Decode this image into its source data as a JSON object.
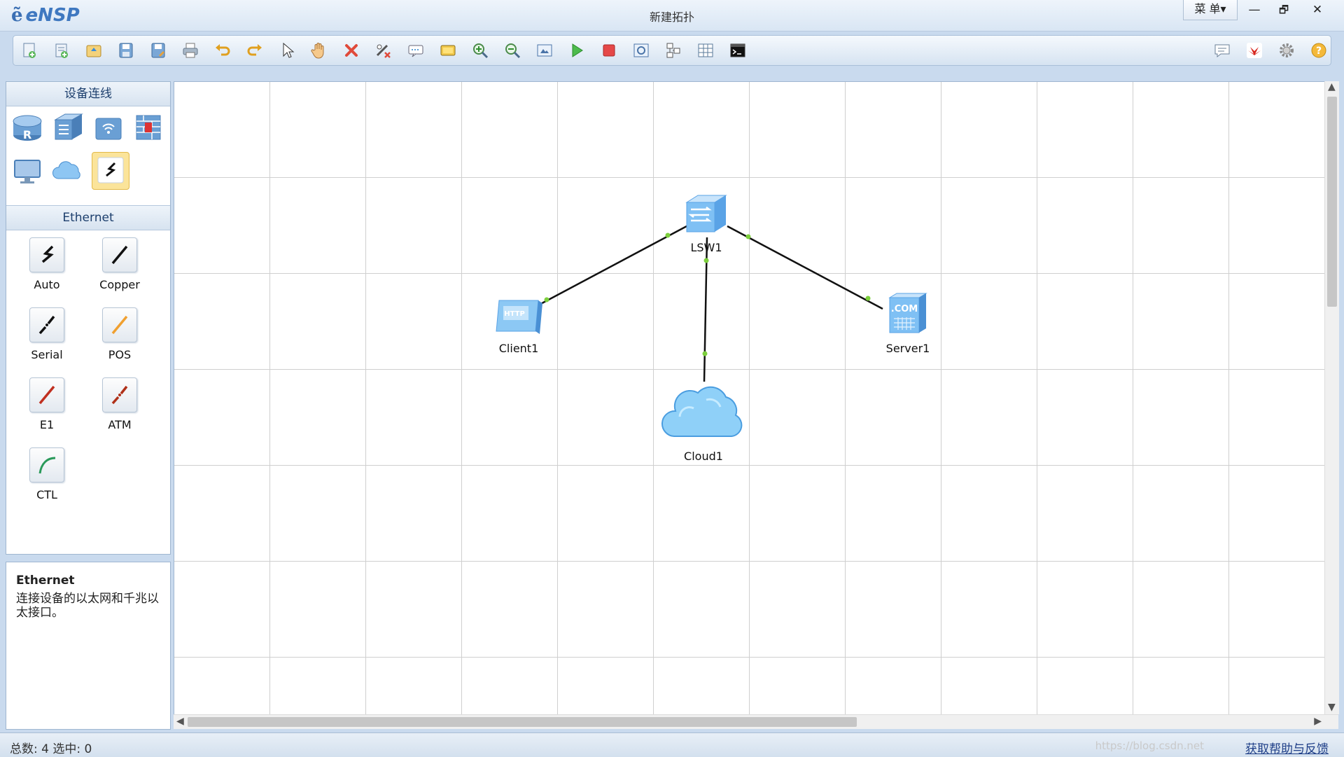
{
  "app": {
    "logo_mark": "ẽ",
    "name": "eNSP",
    "window_title": "新建拓扑",
    "menu_label": "菜 单▾",
    "minimize": "—",
    "restore": "🗗",
    "close": "✕"
  },
  "toolbar": {
    "left_icons": [
      "new-topology-icon",
      "new-example-icon",
      "open-icon",
      "save-icon",
      "save-as-icon",
      "print-icon",
      "undo-icon",
      "redo-icon",
      "select-pointer-icon",
      "hand-pan-icon",
      "delete-icon",
      "delete-link-icon",
      "text-note-icon",
      "palette-icon",
      "zoom-in-icon",
      "zoom-out-icon",
      "fit-view-icon",
      "start-device-icon",
      "stop-device-icon",
      "capture-icon",
      "topology-icon",
      "grid-icon",
      "terminal-icon"
    ],
    "right_icons": [
      "chat-icon",
      "huawei-logo-icon",
      "settings-icon",
      "help-icon"
    ]
  },
  "left_panel": {
    "device_header": "设备连线",
    "devices": [
      "router-icon",
      "switch-icon",
      "wlan-icon",
      "firewall-icon",
      "pc-terminal-icon",
      "cloud-icon",
      "cable-icon"
    ],
    "cable_header": "Ethernet",
    "cables": [
      {
        "label": "Auto",
        "color": "#111111"
      },
      {
        "label": "Copper",
        "color": "#111111"
      },
      {
        "label": "Serial",
        "color": "#111111"
      },
      {
        "label": "POS",
        "color": "#f0a030"
      },
      {
        "label": "E1",
        "color": "#c03020"
      },
      {
        "label": "ATM",
        "color": "#b03018"
      },
      {
        "label": "CTL",
        "color": "#2a9a5a"
      }
    ]
  },
  "info_panel": {
    "title": "Ethernet",
    "description": "连接设备的以太网和千兆以太接口。"
  },
  "topology": {
    "nodes": [
      {
        "id": "LSW1",
        "label": "LSW1",
        "type": "switch"
      },
      {
        "id": "Client1",
        "label": "Client1",
        "type": "client",
        "badge": "HTTP"
      },
      {
        "id": "Server1",
        "label": "Server1",
        "type": "server",
        "badge": ".COM"
      },
      {
        "id": "Cloud1",
        "label": "Cloud1",
        "type": "cloud"
      }
    ],
    "links": [
      {
        "from": "LSW1",
        "to": "Client1"
      },
      {
        "from": "LSW1",
        "to": "Server1"
      },
      {
        "from": "LSW1",
        "to": "Cloud1"
      }
    ],
    "link_color": "#111111",
    "port_color": "#7ccf3c"
  },
  "status_bar": {
    "status": "总数: 4 选中: 0",
    "watermark": "https://blog.csdn.net",
    "help_link": "获取帮助与反馈"
  }
}
